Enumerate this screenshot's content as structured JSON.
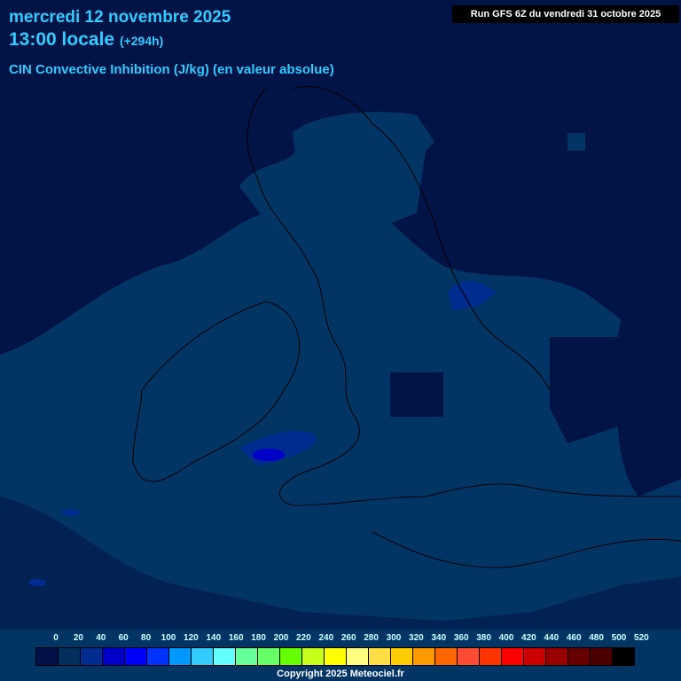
{
  "header": {
    "date": "mercredi 12 novembre 2025",
    "time": "13:00 locale",
    "offset": "(+294h)",
    "parameter": "CIN Convective Inhibition (J/kg) (en valeur absolue)",
    "run": "Run GFS 6Z du vendredi 31 octobre 2025"
  },
  "legend": {
    "labels": [
      "0",
      "20",
      "40",
      "60",
      "80",
      "100",
      "120",
      "140",
      "160",
      "180",
      "200",
      "220",
      "240",
      "260",
      "280",
      "300",
      "320",
      "340",
      "360",
      "380",
      "400",
      "420",
      "440",
      "460",
      "480",
      "500",
      "520"
    ],
    "colors": [
      "#03104a",
      "#01305e",
      "#002b8f",
      "#0000c8",
      "#0000ff",
      "#0033ff",
      "#0099ff",
      "#33ccff",
      "#66ffff",
      "#66ff99",
      "#66ff66",
      "#66ff00",
      "#c6ff1a",
      "#ffff00",
      "#ffff80",
      "#ffdd44",
      "#ffcc00",
      "#ff9900",
      "#ff6600",
      "#ff4c33",
      "#ff3300",
      "#ff0000",
      "#cc0000",
      "#990000",
      "#660000",
      "#4c0000",
      "#000000"
    ]
  },
  "copyright": "Copyright 2025 Meteociel.fr"
}
